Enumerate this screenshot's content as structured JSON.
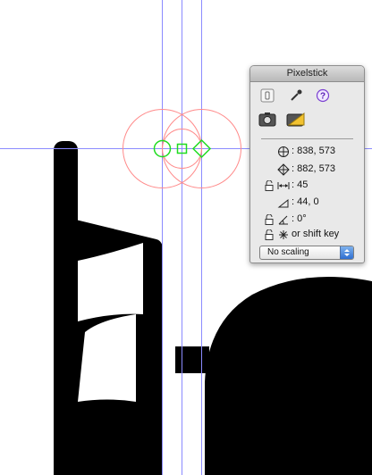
{
  "window": {
    "title": "Pixelstick"
  },
  "tools": {
    "icons": [
      "toggle-switch-icon",
      "eyedropper-icon",
      "help-icon",
      "camera-icon",
      "ruler-camera-icon"
    ]
  },
  "readouts": {
    "start_point": "838, 573",
    "end_point": "882, 573",
    "distance": "45",
    "delta": "44, 0",
    "angle": "0°",
    "constrain": "or shift key"
  },
  "scaling": {
    "selected": "No scaling"
  },
  "colors": {
    "guide_line": "#8b8bff",
    "handle_green": "#1fdc1f",
    "circle_red": "#ff8a8a"
  }
}
